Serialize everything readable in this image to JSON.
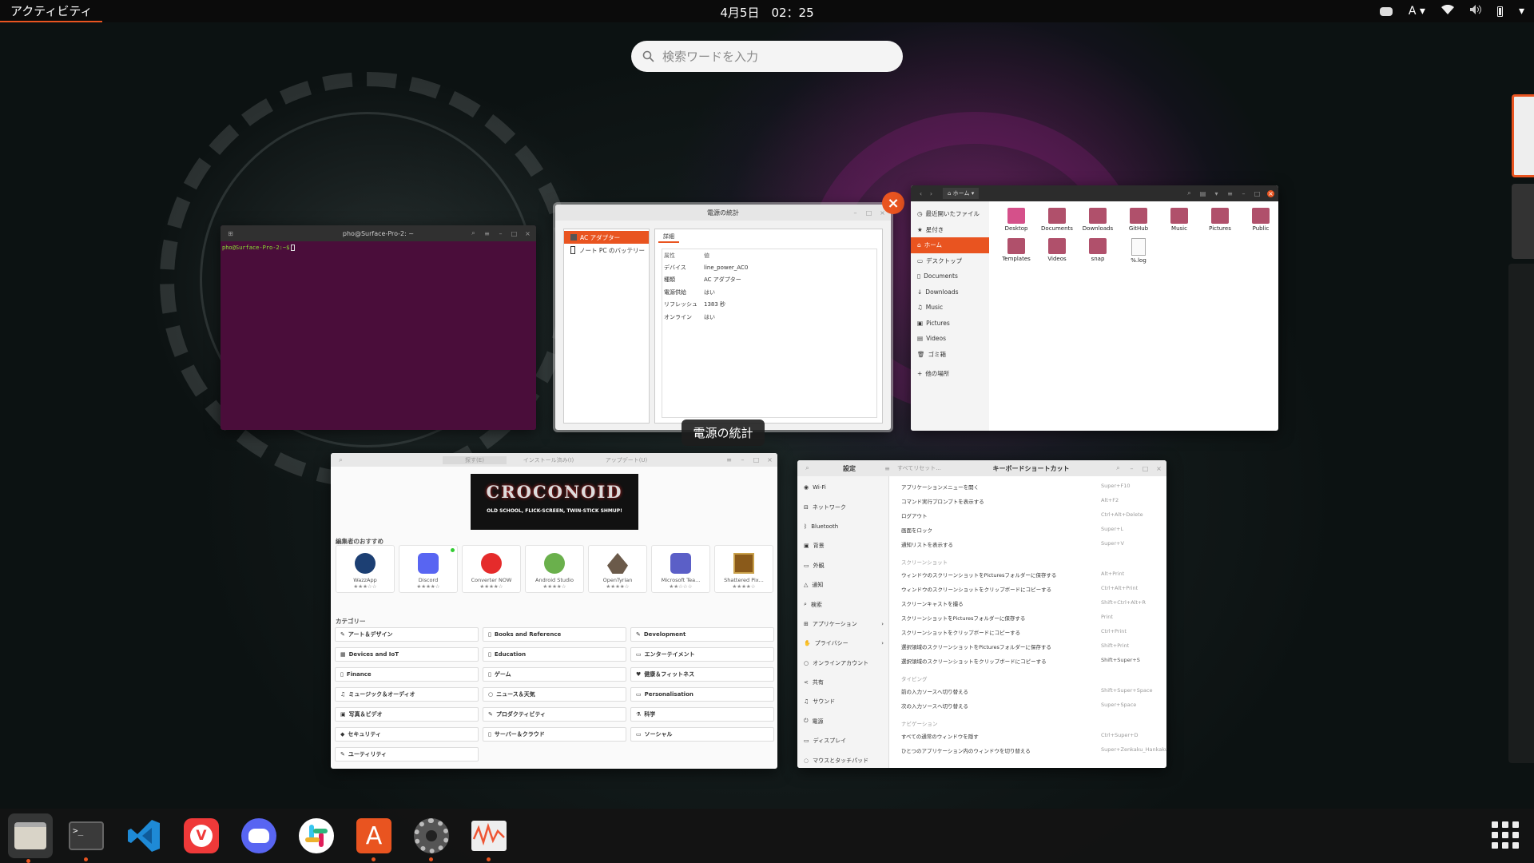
{
  "topbar": {
    "activities": "アクティビティ",
    "clock": "4月5日　02：25",
    "input_indicator": "A"
  },
  "search": {
    "placeholder": "検索ワードを入力"
  },
  "terminal": {
    "title": "pho@Surface-Pro-2: ~",
    "prompt": "pho@Surface-Pro-2:~$"
  },
  "power": {
    "title": "電源の統計",
    "devices": [
      "AC アダプター",
      "ノート PC のバッテリー"
    ],
    "tab": "詳細",
    "col_attr": "属性",
    "col_val": "値",
    "rows": [
      [
        "デバイス",
        "line_power_AC0"
      ],
      [
        "種類",
        "AC アダプター"
      ],
      [
        "電源供給",
        "はい"
      ],
      [
        "リフレッシュ",
        "1383 秒"
      ],
      [
        "オンライン",
        "はい"
      ]
    ],
    "tooltip": "電源の統計"
  },
  "files": {
    "location": "ホーム",
    "sidebar": [
      "最近開いたファイル",
      "星付き",
      "ホーム",
      "デスクトップ",
      "Documents",
      "Downloads",
      "Music",
      "Pictures",
      "Videos",
      "ゴミ箱",
      "他の場所"
    ],
    "items": [
      "Desktop",
      "Documents",
      "Downloads",
      "GitHub",
      "Music",
      "Pictures",
      "Public",
      "Templates",
      "Videos",
      "snap",
      "%.log"
    ]
  },
  "software": {
    "tabs": [
      "探す(E)",
      "インストール済み(I)",
      "アップデート(U)"
    ],
    "banner_title": "CROCONOID",
    "banner_sub": "OLD SCHOOL, FLICK-SCREEN, TWIN-STICK SHMUP!",
    "picks_title": "編集者のおすすめ",
    "apps": [
      "WazzApp",
      "Discord",
      "Converter NOW",
      "Android Studio",
      "OpenTyrian",
      "Microsoft Tea...",
      "Shattered Pix..."
    ],
    "cat_title": "カテゴリー",
    "cats": [
      "アート＆デザイン",
      "Books and Reference",
      "Development",
      "Devices and IoT",
      "Education",
      "エンターテイメント",
      "Finance",
      "ゲーム",
      "健康＆フィットネス",
      "ミュージック＆オーディオ",
      "ニュース＆天気",
      "Personalisation",
      "写真＆ビデオ",
      "プロダクティビティ",
      "科学",
      "セキュリティ",
      "サーバー＆クラウド",
      "ソーシャル",
      "ユーティリティ"
    ]
  },
  "settings": {
    "title": "設定",
    "search_hint": "すべてリセット...",
    "panel_title": "キーボードショートカット",
    "nav": [
      "Wi-Fi",
      "ネットワーク",
      "Bluetooth",
      "背景",
      "外観",
      "通知",
      "検索",
      "アプリケーション",
      "プライバシー",
      "オンラインアカウント",
      "共有",
      "サウンド",
      "電源",
      "ディスプレイ",
      "マウスとタッチパッド"
    ],
    "rows": [
      [
        "アプリケーションメニューを開く",
        "Super+F10"
      ],
      [
        "コマンド実行プロンプトを表示する",
        "Alt+F2"
      ],
      [
        "ログアウト",
        "Ctrl+Alt+Delete"
      ],
      [
        "画面をロック",
        "Super+L"
      ],
      [
        "通知リストを表示する",
        "Super+V"
      ]
    ],
    "sec_screenshot": "スクリーンショット",
    "rows2": [
      [
        "ウィンドウのスクリーンショットをPicturesフォルダーに保存する",
        "Alt+Print"
      ],
      [
        "ウィンドウのスクリーンショットをクリップボードにコピーする",
        "Ctrl+Alt+Print"
      ],
      [
        "スクリーンキャストを撮る",
        "Shift+Ctrl+Alt+R"
      ],
      [
        "スクリーンショットをPicturesフォルダーに保存する",
        "Print"
      ],
      [
        "スクリーンショットをクリップボードにコピーする",
        "Ctrl+Print"
      ],
      [
        "選択領域のスクリーンショットをPicturesフォルダーに保存する",
        "Shift+Print"
      ],
      [
        "選択領域のスクリーンショットをクリップボードにコピーする",
        "Shift+Super+S"
      ]
    ],
    "sec_typing": "タイピング",
    "rows3": [
      [
        "前の入力ソースへ切り替える",
        "Shift+Super+Space"
      ],
      [
        "次の入力ソースへ切り替える",
        "Super+Space"
      ]
    ],
    "sec_nav": "ナビゲーション",
    "rows4": [
      [
        "すべての通常のウィンドウを隠す",
        "Ctrl+Super+D"
      ],
      [
        "ひとつのアプリケーション内のウィンドウを切り替える",
        "Super+Zenkaku_Hankaku"
      ]
    ]
  },
  "dock": [
    "files",
    "terminal",
    "vscode",
    "vivaldi",
    "discord",
    "slack",
    "software",
    "settings",
    "system-monitor"
  ],
  "colors": {
    "accent": "#e95420",
    "terminal_bg": "#4a0d3a",
    "topbar": "#0b0b0b"
  }
}
